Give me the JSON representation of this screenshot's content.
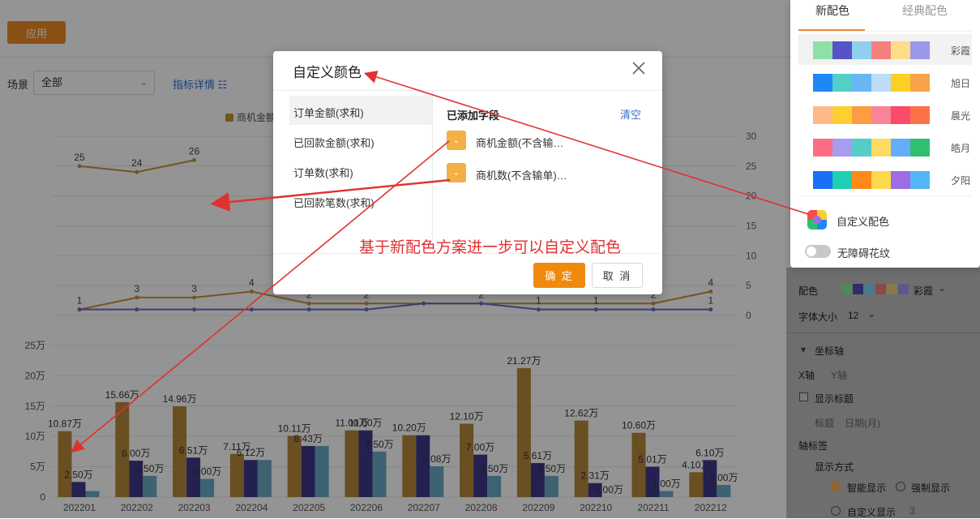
{
  "toolbar": {
    "apply_label": "应用"
  },
  "filters": {
    "scene_label": "场景",
    "scene_value": "全部",
    "metric_link": "指标详情 ☷"
  },
  "top_chart": {
    "legend_label": "商机金额"
  },
  "chart_data": [
    {
      "type": "line",
      "categories": [
        "202201",
        "202202",
        "202203",
        "202204",
        "202205",
        "202206",
        "202207",
        "202208",
        "202209",
        "202210",
        "202211",
        "202212"
      ],
      "series": [
        {
          "values": [
            25,
            24,
            26,
            null,
            null,
            null,
            null,
            null,
            null,
            null,
            null,
            null
          ],
          "color": "#c8923b"
        },
        {
          "values": [
            1,
            3,
            3,
            4,
            2,
            2,
            null,
            null,
            null,
            null,
            2,
            4
          ],
          "color": "#c8923b"
        },
        {
          "values": [
            1,
            1,
            1,
            1,
            1,
            1,
            2,
            2,
            1,
            1,
            1,
            1
          ],
          "color": "#6c6cc2"
        }
      ],
      "data_labels": [
        "25",
        "24",
        "26",
        "3",
        "3",
        "4",
        "2",
        "2",
        "2",
        "2",
        "1",
        "1",
        "2",
        "1",
        "4",
        "1",
        "1"
      ],
      "y_right_ticks": [
        "30",
        "25",
        "20",
        "15",
        "10",
        "5",
        "0"
      ],
      "ylim": [
        0,
        30
      ]
    },
    {
      "type": "bar",
      "categories": [
        "202201",
        "202202",
        "202203",
        "202204",
        "202205",
        "202206",
        "202207",
        "202208",
        "202209",
        "202210",
        "202211",
        "202212"
      ],
      "series": [
        {
          "values": [
            10.87,
            15.66,
            14.96,
            7.11,
            10.11,
            11.0,
            10.2,
            12.1,
            21.27,
            12.62,
            10.6,
            4.1
          ],
          "labels": [
            "10.87万",
            "15.66万",
            "14.96万",
            "7.11万",
            "10.11万",
            "11.00万",
            "10.20万",
            "12.10万",
            "21.27万",
            "12.62万",
            "10.60万",
            "4.10万"
          ],
          "color": "#b5883a"
        },
        {
          "values": [
            2.5,
            6.0,
            6.51,
            6.12,
            8.43,
            11.0,
            10.2,
            7.0,
            5.61,
            2.31,
            5.01,
            6.1
          ],
          "labels": [
            "2.50万",
            "6.00万",
            "6.51万",
            "6.12万",
            "8.43万",
            "11.00万",
            "",
            "7.00万",
            "5.61万",
            "2.31万",
            "5.01万",
            "6.10万"
          ],
          "color": "#3e3a8c"
        },
        {
          "values": [
            1.0,
            3.5,
            3.0,
            6.12,
            8.43,
            7.5,
            5.08,
            3.5,
            3.5,
            0.0,
            1.0,
            2.0
          ],
          "labels": [
            "",
            "3.50万",
            "3.00万",
            "",
            "",
            "7.50万",
            "5.08万",
            "3.50万",
            "3.50万",
            "0.00万",
            "1.00万",
            "2.00万"
          ],
          "color": "#6aaac3"
        }
      ],
      "y_ticks": [
        "25万",
        "20万",
        "15万",
        "10万",
        "5万",
        "0"
      ],
      "ylim": [
        0,
        25
      ]
    }
  ],
  "right_panel": {
    "color_label": "配色",
    "color_value": "彩霞",
    "font_size_label": "字体大小",
    "font_size_value": "12",
    "axis_section": "坐标轴",
    "x_axis": "X轴",
    "y_axis": "Y轴",
    "show_title": "显示标题",
    "title_label": "标题",
    "title_value": "日期(月)",
    "axis_label": "轴标签",
    "display_mode": "显示方式",
    "smart_display": "智能显示",
    "force_display": "强制显示",
    "custom_display": "自定义显示",
    "custom_value": "3"
  },
  "modal": {
    "title": "自定义颜色",
    "fields": [
      "订单金额(求和)",
      "已回款金额(求和)",
      "订单数(求和)",
      "已回款笔数(求和)"
    ],
    "added_title": "已添加字段",
    "clear_label": "清空",
    "added": [
      {
        "label": "商机金额(不含输…",
        "color": "#f3b145"
      },
      {
        "label": "商机数(不含输单)…",
        "color": "#f3b145"
      }
    ],
    "ok_label": "确 定",
    "cancel_label": "取 消"
  },
  "annotation": "基于新配色方案进一步可以自定义配色",
  "popover": {
    "tabs": [
      "新配色",
      "经典配色"
    ],
    "palettes": [
      {
        "name": "彩霞",
        "colors": [
          "#8fe0a6",
          "#5553c7",
          "#8fd0ef",
          "#f47f7f",
          "#fddd8a",
          "#9a98ea"
        ]
      },
      {
        "name": "旭日",
        "colors": [
          "#1e88f5",
          "#53cfc8",
          "#68b6f2",
          "#bcdcf8",
          "#fccf26",
          "#f8a24a"
        ]
      },
      {
        "name": "晨光",
        "colors": [
          "#fdb98a",
          "#fed02f",
          "#fb9d43",
          "#f9849a",
          "#fb4a6a",
          "#fb7249"
        ]
      },
      {
        "name": "皓月",
        "colors": [
          "#fc6d85",
          "#a89cf0",
          "#56ccc6",
          "#fddb63",
          "#63adf9",
          "#2fc06f"
        ]
      },
      {
        "name": "夕阳",
        "colors": [
          "#1a6ff7",
          "#1ecfb1",
          "#fd8a19",
          "#fcd949",
          "#9d6ce6",
          "#53b6f6"
        ]
      }
    ],
    "custom_label": "自定义配色",
    "accessible_label": "无障碍花纹"
  }
}
